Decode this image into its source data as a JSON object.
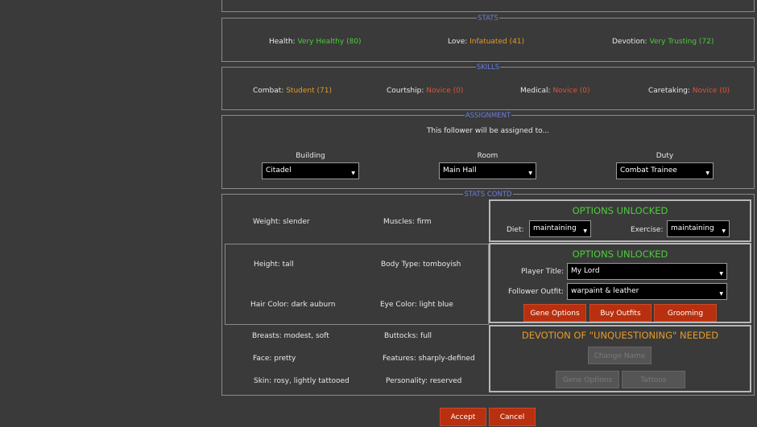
{
  "sections": {
    "stats": "STATS",
    "skills": "SKILLS",
    "assignment": "ASSIGNMENT",
    "stats_contd": "STATS CONTD"
  },
  "stats": [
    {
      "label": "Health: ",
      "value": "Very Healthy (80)",
      "color": "#4ccc3a"
    },
    {
      "label": "Love: ",
      "value": "Infatuated (41)",
      "color": "#e59b2a"
    },
    {
      "label": "Devotion: ",
      "value": "Very Trusting (72)",
      "color": "#4ccc3a"
    }
  ],
  "skills": [
    {
      "label": "Combat: ",
      "value": "Student (71)",
      "color": "#e59b2a"
    },
    {
      "label": "Courtship: ",
      "value": "Novice (0)",
      "color": "#e0533c"
    },
    {
      "label": "Medical: ",
      "value": "Novice (0)",
      "color": "#e0533c"
    },
    {
      "label": "Caretaking: ",
      "value": "Novice (0)",
      "color": "#e0533c"
    }
  ],
  "assignment": {
    "intro": "This follower will be assigned to...",
    "building_label": "Building",
    "building_value": "Citadel",
    "room_label": "Room",
    "room_value": "Main Hall",
    "duty_label": "Duty",
    "duty_value": "Combat Trainee"
  },
  "body": {
    "weight": "Weight: slender",
    "muscles": "Muscles: firm",
    "height": "Height:  tall",
    "body_type": "Body Type:  tomboyish",
    "hair": "Hair Color: dark auburn",
    "eye": "Eye Color: light blue",
    "breasts": "Breasts:  modest, soft",
    "buttocks": "Buttocks:  full",
    "face": "Face: pretty",
    "features": "Features: sharply-defined",
    "skin": "Skin: rosy, lightly tattooed",
    "personality": "Personality: reserved"
  },
  "options1": {
    "title": "OPTIONS UNLOCKED",
    "diet_label": "Diet:",
    "diet_value": "maintaining",
    "exercise_label": "Exercise:",
    "exercise_value": "maintaining"
  },
  "options2": {
    "title": "OPTIONS UNLOCKED",
    "player_title_label": "Player Title:",
    "player_title_value": "My Lord",
    "outfit_label": "Follower Outfit:",
    "outfit_value": "warpaint & leather",
    "gene_options": "Gene Options",
    "buy_outfits": "Buy Outfits",
    "grooming": "Grooming"
  },
  "devotion": {
    "title": "DEVOTION OF \"UNQUESTIONING\" NEEDED",
    "change_name": "Change Name",
    "gene_options": "Gene Options",
    "tattoos": "Tattoos"
  },
  "footer": {
    "accept": "Accept",
    "cancel": "Cancel"
  },
  "colors": {
    "accent_blue": "#6a7fd9",
    "good": "#4ccc3a",
    "warn": "#e59b2a",
    "bad": "#e0533c",
    "button": "#b8300f"
  },
  "icons": {
    "dropdown": "chevron-down-icon"
  }
}
